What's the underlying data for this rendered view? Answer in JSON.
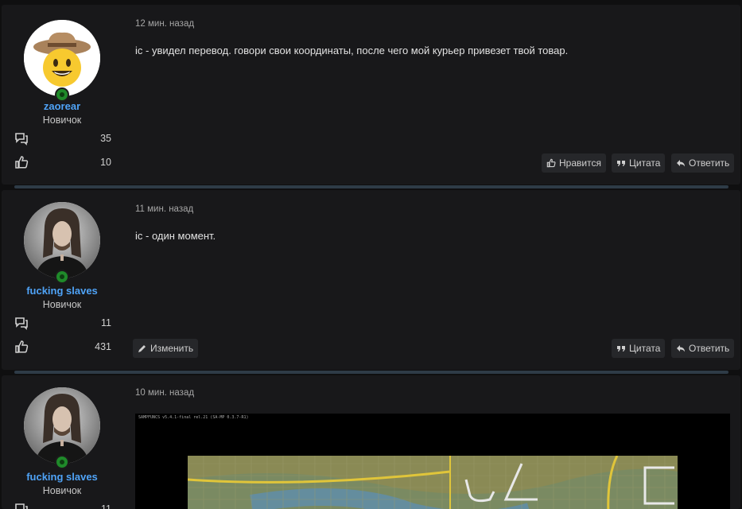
{
  "posts": [
    {
      "time": "12 мин. назад",
      "message": "ic - увидел перевод. говори свои координаты, после чего мой курьер привезет твой товар.",
      "username": "zaorear",
      "user_title": "Новичок",
      "messages_count": "35",
      "reactions_count": "10",
      "avatar": "cowboy-emoji",
      "actions": {
        "like": "Нравится",
        "quote": "Цитата",
        "reply": "Ответить"
      }
    },
    {
      "time": "11 мин. назад",
      "message": "ic - один момент.",
      "username": "fucking slaves",
      "user_title": "Новичок",
      "messages_count": "11",
      "reactions_count": "431",
      "avatar": "photo",
      "actions": {
        "edit": "Изменить",
        "quote": "Цитата",
        "reply": "Ответить"
      }
    },
    {
      "time": "10 мин. назад",
      "username": "fucking slaves",
      "user_title": "Новичок",
      "messages_count": "11",
      "avatar": "photo",
      "attachment": {
        "caption": "SAMPFUNCS v5.4.1-final rel.21 (SA-MP 0.3.7-R1)"
      }
    }
  ],
  "colors": {
    "accent": "#4fa3f7",
    "online": "#1f8a2a",
    "background": "#18181a",
    "divider": "#2e3b47"
  }
}
